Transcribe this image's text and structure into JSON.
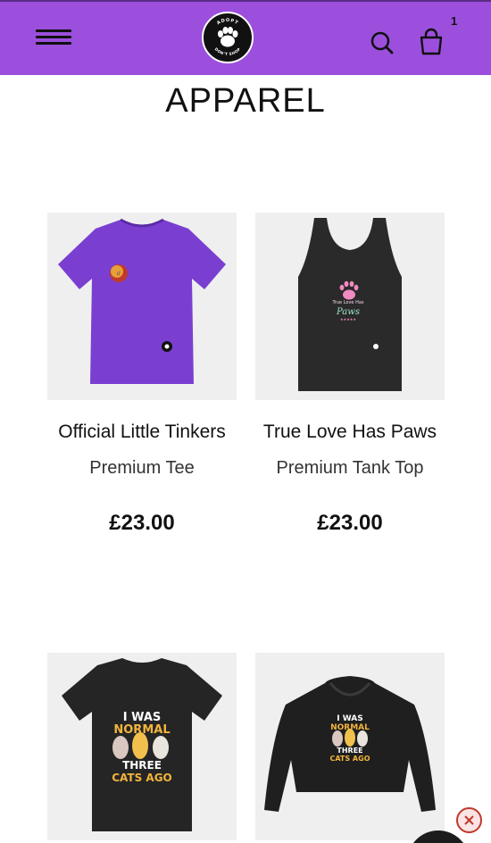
{
  "header": {
    "menu_icon": "hamburger-menu-icon",
    "logo": {
      "top_text": "ADOPT",
      "bottom_text": "DON'T SHOP",
      "icon": "paw-icon"
    },
    "search_icon": "search-icon",
    "cart_icon": "shopping-bag-icon",
    "cart_count": "1",
    "background_color": "#9b4fdc"
  },
  "page": {
    "title": "APPAREL"
  },
  "products": [
    {
      "name": "Official Little Tinkers",
      "type": "Premium Tee",
      "price": "£23.00",
      "garment_color": "#7a3fd1",
      "print_text": ""
    },
    {
      "name": "True Love Has Paws",
      "type": "Premium Tank Top",
      "price": "£23.00",
      "garment_color": "#2a2a2a",
      "print_text": "True Love Has Paws"
    },
    {
      "name": "",
      "type": "",
      "price": "",
      "garment_color": "#252525",
      "print_text": "I WAS NORMAL THREE CATS AGO"
    },
    {
      "name": "",
      "type": "",
      "price": "",
      "garment_color": "#1f1f1f",
      "print_text": "I WAS NORMAL THREE CATS AGO"
    }
  ],
  "overlay": {
    "close_icon": "close-x-icon"
  }
}
